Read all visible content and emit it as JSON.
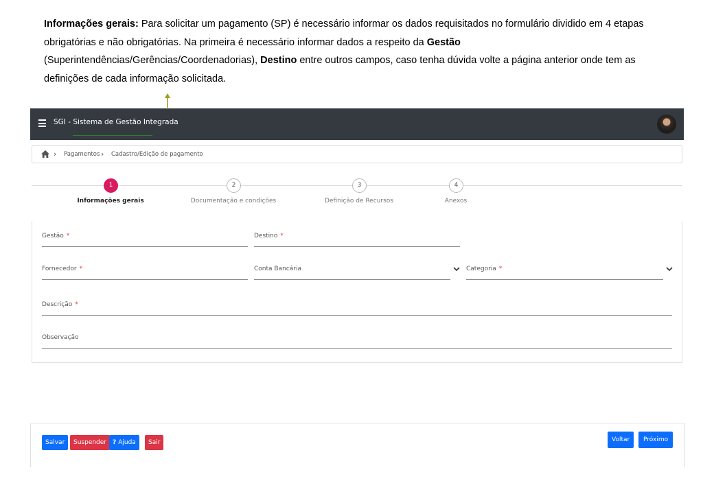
{
  "instructions": {
    "label_bold": "Informações gerais:",
    "text_part1": " Para solicitar um pagamento (SP) é necessário informar os dados requisitados no formulário dividido  em 4 etapas obrigatórias e não obrigatórias. Na primeira é necessário informar dados a respeito da ",
    "gestao_bold": "Gestão",
    "text_part2": " (Superintendências/Gerências/Coordenadorias), ",
    "destino_bold": "Destino",
    "text_part3": " entre outros campos, caso tenha dúvida  volte  a página anterior onde tem as definições de cada informação solicitada."
  },
  "colors": {
    "appbar": "#343a40",
    "active_step": "#d81b60",
    "primary_button": "#0d6efd",
    "danger_button": "#dc3545",
    "required_marker": "#e53935",
    "arrow": "#9e9e1f"
  },
  "header": {
    "menu_icon": "hamburger-icon",
    "title": "SGI - Sistema de Gestão Integrada",
    "avatar_icon": "user-avatar"
  },
  "breadcrumb": {
    "home_icon": "home-icon",
    "items": [
      "Pagamentos",
      "Cadastro/Edição de pagamento"
    ]
  },
  "stepper": {
    "steps": [
      {
        "number": "1",
        "label": "Informações gerais",
        "active": true
      },
      {
        "number": "2",
        "label": "Documentação e condições",
        "active": false
      },
      {
        "number": "3",
        "label": "Definição de Recursos",
        "active": false
      },
      {
        "number": "4",
        "label": "Anexos",
        "active": false
      }
    ]
  },
  "form": {
    "required_mark": "*",
    "gestao": {
      "label": "Gestão",
      "required": true,
      "value": ""
    },
    "destino": {
      "label": "Destino",
      "required": true,
      "value": ""
    },
    "fornecedor": {
      "label": "Fornecedor",
      "required": true,
      "value": ""
    },
    "conta_bancaria": {
      "label": "Conta Bancária",
      "required": false,
      "value": "",
      "icon": "chevron-down-icon"
    },
    "categoria": {
      "label": "Categoria",
      "required": true,
      "value": "",
      "icon": "chevron-down-icon"
    },
    "descricao": {
      "label": "Descrição",
      "required": true,
      "value": ""
    },
    "observacao": {
      "label": "Observação",
      "required": false,
      "value": ""
    }
  },
  "footer": {
    "save_label": "Salvar",
    "suspend_label": "Suspender",
    "help_icon_text": "?",
    "help_label": "Ajuda",
    "exit_label": "Sair",
    "back_label": "Voltar",
    "next_label": "Próximo"
  }
}
